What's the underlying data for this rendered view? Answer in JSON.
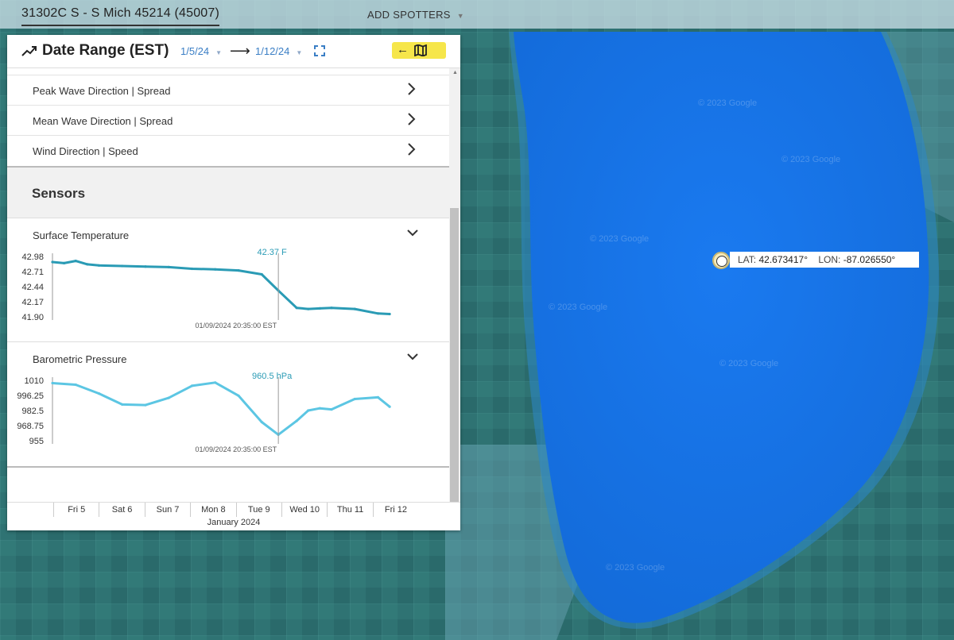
{
  "header": {
    "station": "31302C S - S Mich 45214 (45007)",
    "add_spotters": "ADD SPOTTERS"
  },
  "marker": {
    "lat_label": "LAT:",
    "lat_value": "42.673417°",
    "lon_label": "LON:",
    "lon_value": "-87.026550°"
  },
  "map": {
    "watermark": "© 2023 Google"
  },
  "panel": {
    "title": "Date Range (EST)",
    "date_start": "1/5/24",
    "date_end": "1/12/24",
    "arrow": "⟶",
    "map_toggle_arrow": "←",
    "icons": [
      "trend-icon",
      "fullscreen-icon",
      "map-icon",
      "chevron-right-icon",
      "chevron-down-icon"
    ]
  },
  "menu": {
    "items": [
      {
        "label": "Peak Wave Direction | Spread"
      },
      {
        "label": "Mean Wave Direction | Spread"
      },
      {
        "label": "Wind Direction | Speed"
      }
    ]
  },
  "sensors": {
    "title": "Sensors",
    "temperature": {
      "name": "Surface Temperature",
      "cursor_value": "42.37 F",
      "cursor_time": "01/09/2024 20:35:00 EST",
      "y_ticks": [
        "42.98",
        "42.71",
        "42.44",
        "42.17",
        "41.90"
      ],
      "color": "#2a9bb5"
    },
    "pressure": {
      "name": "Barometric Pressure",
      "cursor_value": "960.5 hPa",
      "cursor_time": "01/09/2024 20:35:00 EST",
      "y_ticks": [
        "1010",
        "996.25",
        "982.5",
        "968.75",
        "955"
      ],
      "color": "#5cc6e3"
    }
  },
  "chart_data": [
    {
      "type": "line",
      "title": "Surface Temperature",
      "ylabel": "",
      "ylim": [
        41.9,
        42.98
      ],
      "x": [
        "1/5 00:00",
        "1/5 06:00",
        "1/5 12:00",
        "1/5 18:00",
        "1/6 00:00",
        "1/6 12:00",
        "1/7 00:00",
        "1/7 12:00",
        "1/8 00:00",
        "1/8 12:00",
        "1/9 00:00",
        "1/9 12:00",
        "1/9 20:35",
        "1/10 06:00",
        "1/10 12:00",
        "1/10 18:00",
        "1/11 00:00",
        "1/11 12:00",
        "1/12 00:00",
        "1/12 06:00"
      ],
      "series": [
        {
          "values": [
            42.88,
            42.86,
            42.9,
            42.84,
            42.82,
            42.81,
            42.8,
            42.79,
            42.76,
            42.75,
            42.73,
            42.66,
            42.37,
            42.06,
            42.04,
            42.05,
            42.06,
            42.04,
            41.96,
            41.95
          ]
        }
      ],
      "grid": false,
      "cursor": {
        "x": "1/9 20:35",
        "label": "42.37 F"
      }
    },
    {
      "type": "line",
      "title": "Barometric Pressure",
      "ylabel": "",
      "ylim": [
        955,
        1010
      ],
      "x": [
        "1/5 00:00",
        "1/5 12:00",
        "1/6 00:00",
        "1/6 12:00",
        "1/7 00:00",
        "1/7 12:00",
        "1/8 00:00",
        "1/8 12:00",
        "1/9 00:00",
        "1/9 12:00",
        "1/9 20:35",
        "1/10 06:00",
        "1/10 12:00",
        "1/10 18:00",
        "1/11 00:00",
        "1/11 12:00",
        "1/12 00:00",
        "1/12 06:00"
      ],
      "series": [
        {
          "values": [
            1007.5,
            1006.0,
            998.0,
            988.0,
            987.5,
            994.0,
            1005.0,
            1008.0,
            996.0,
            972.0,
            960.5,
            973.0,
            982.5,
            984.5,
            983.5,
            993.0,
            994.5,
            986.0
          ]
        }
      ],
      "grid": false,
      "cursor": {
        "x": "1/9 20:35",
        "label": "960.5 hPa"
      }
    }
  ],
  "timeline": {
    "days": [
      "Fri 5",
      "Sat 6",
      "Sun 7",
      "Mon 8",
      "Tue 9",
      "Wed 10",
      "Thu 11",
      "Fri 12"
    ],
    "month": "January 2024"
  }
}
